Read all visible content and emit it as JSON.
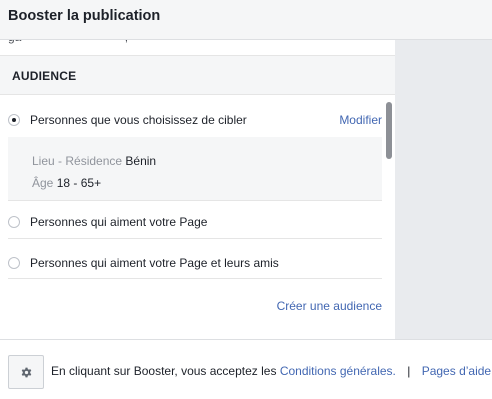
{
  "header": {
    "title": "Booster la publication"
  },
  "audience": {
    "section_title": "AUDIENCE",
    "options": [
      {
        "label": "Personnes que vous choisissez de cibler",
        "selected": true,
        "action": "Modifier"
      },
      {
        "label": "Personnes qui aiment votre Page",
        "selected": false
      },
      {
        "label": "Personnes qui aiment votre Page et leurs amis",
        "selected": false
      }
    ],
    "details": {
      "location_label": "Lieu - Résidence",
      "location_value": "Bénin",
      "age_label": "Âge",
      "age_value": "18 - 65+"
    },
    "create_link": "Créer une audience"
  },
  "footer": {
    "text": "En cliquant sur Booster, vous acceptez les",
    "terms_link": "Conditions générales.",
    "separator": "|",
    "help_link": "Pages d’aide",
    "settings_icon": "gear-icon"
  },
  "colors": {
    "link": "#4267b2",
    "panel_bg": "#e9ebee",
    "header_bg": "#f5f6f7"
  }
}
